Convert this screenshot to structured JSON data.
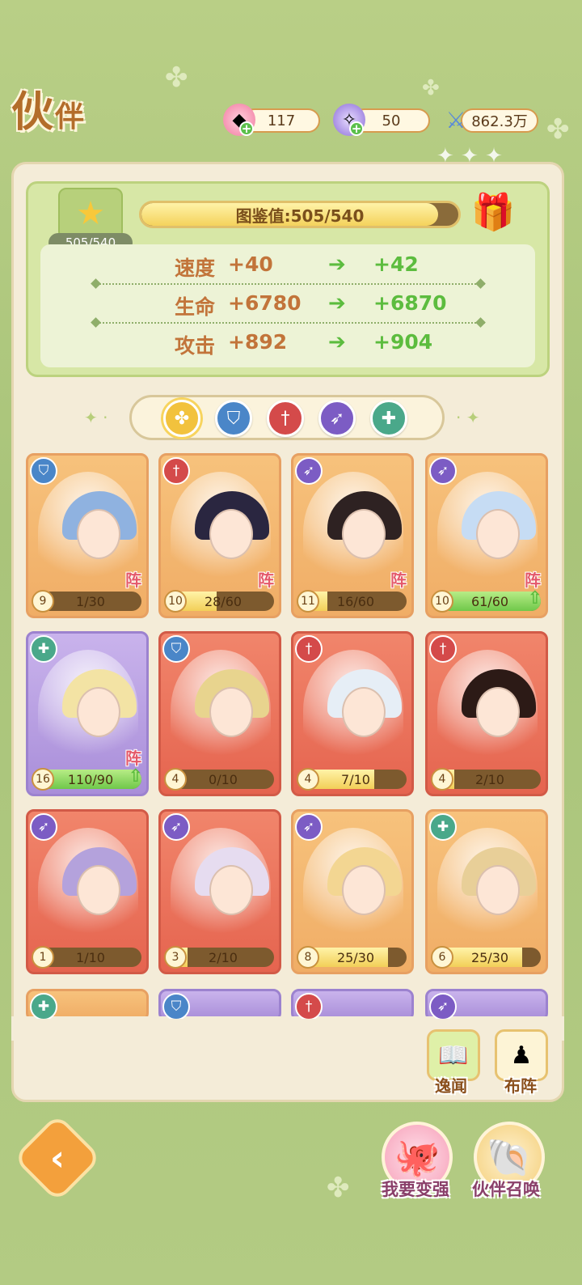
{
  "header": {
    "title_main": "伙",
    "title_sub": "伴",
    "resources": [
      {
        "icon": "pink-gem-icon",
        "value": "117"
      },
      {
        "icon": "purple-crystal-icon",
        "value": "50"
      },
      {
        "icon": "crossed-swords-icon",
        "value": "862.3万"
      }
    ]
  },
  "collection": {
    "star_count": "505/540",
    "progress_label": "图鉴值:505/540",
    "progress_fraction": 0.935,
    "stats": [
      {
        "name": "速度",
        "current": "+40",
        "next": "+42"
      },
      {
        "name": "生命",
        "current": "+6780",
        "next": "+6870"
      },
      {
        "name": "攻击",
        "current": "+892",
        "next": "+904"
      }
    ]
  },
  "filters": [
    {
      "icon": "clover-icon",
      "color": "#f2c23d",
      "active": true
    },
    {
      "icon": "shield-icon",
      "color": "#4a86c8"
    },
    {
      "icon": "sword-icon",
      "color": "#d44a4a"
    },
    {
      "icon": "bow-icon",
      "color": "#7c5cc4"
    },
    {
      "icon": "heal-icon",
      "color": "#4aa88a"
    }
  ],
  "cards": [
    {
      "type": "shield",
      "bg": "orange",
      "level": "9",
      "shards": "1/30",
      "fill": 0.033,
      "zhen": "阵",
      "hair": "#8fb2e0"
    },
    {
      "type": "sword",
      "bg": "orange",
      "level": "10",
      "shards": "28/60",
      "fill": 0.47,
      "zhen": "阵",
      "hair": "#2a2640"
    },
    {
      "type": "bow",
      "bg": "orange",
      "level": "11",
      "shards": "16/60",
      "fill": 0.27,
      "zhen": "阵",
      "hair": "#2e2222"
    },
    {
      "type": "bow",
      "bg": "orange",
      "level": "10",
      "shards": "61/60",
      "fill": 1.0,
      "zhen": "阵",
      "up": true,
      "hair": "#c6dcf4"
    },
    {
      "type": "heal",
      "bg": "purple",
      "level": "16",
      "shards": "110/90",
      "fill": 1.0,
      "zhen": "阵",
      "up": true,
      "hair": "#f3e3a4"
    },
    {
      "type": "shield",
      "bg": "red",
      "level": "4",
      "shards": "0/10",
      "fill": 0.0,
      "hair": "#e8d48e"
    },
    {
      "type": "sword",
      "bg": "red",
      "level": "4",
      "shards": "7/10",
      "fill": 0.7,
      "hair": "#e6eef6"
    },
    {
      "type": "sword",
      "bg": "red",
      "level": "4",
      "shards": "2/10",
      "fill": 0.2,
      "hair": "#2c1a16"
    },
    {
      "type": "bow",
      "bg": "red",
      "level": "1",
      "shards": "1/10",
      "fill": 0.1,
      "hair": "#b4a2dc"
    },
    {
      "type": "bow",
      "bg": "red",
      "level": "3",
      "shards": "2/10",
      "fill": 0.2,
      "hair": "#e6dcf0"
    },
    {
      "type": "bow",
      "bg": "orange",
      "level": "8",
      "shards": "25/30",
      "fill": 0.83,
      "hair": "#f3d692"
    },
    {
      "type": "heal",
      "bg": "orange",
      "level": "6",
      "shards": "25/30",
      "fill": 0.83,
      "hair": "#e8cf98"
    },
    {
      "type": "heal",
      "bg": "orange",
      "partial": true
    },
    {
      "type": "shield",
      "bg": "purple",
      "partial": true
    },
    {
      "type": "sword",
      "bg": "purple",
      "partial": true
    },
    {
      "type": "bow",
      "bg": "purple",
      "partial": true
    }
  ],
  "side_buttons": {
    "lore_label": "逸闻",
    "formation_label": "布阵"
  },
  "bottom": {
    "strengthen_label": "我要变强",
    "summon_label": "伙伴召唤"
  }
}
